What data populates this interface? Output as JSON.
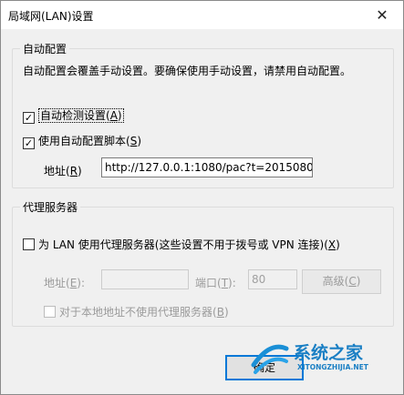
{
  "window": {
    "title": "局域网(LAN)设置",
    "close_glyph": "✕"
  },
  "auto_config": {
    "group_title": "自动配置",
    "description": "自动配置会覆盖手动设置。要确保使用手动设置，请禁用自动配置。",
    "auto_detect": {
      "label": "自动检测设置",
      "accel": "A",
      "checked": true
    },
    "use_script": {
      "label": "使用自动配置脚本",
      "accel": "S",
      "checked": true
    },
    "address_label": "地址",
    "address_accel": "R",
    "address_value": "http://127.0.0.1:1080/pac?t=2015080"
  },
  "proxy": {
    "group_title": "代理服务器",
    "use_proxy": {
      "label": "为 LAN 使用代理服务器(这些设置不用于拨号或 VPN 连接)",
      "accel": "X",
      "checked": false
    },
    "address_label": "地址",
    "address_accel": "E",
    "address_value": "",
    "port_label": "端口",
    "port_accel": "T",
    "port_value": "80",
    "advanced_label": "高级",
    "advanced_accel": "C",
    "bypass": {
      "label": "对于本地地址不使用代理服务器",
      "accel": "B",
      "checked": false
    }
  },
  "footer": {
    "ok_label": "确定"
  },
  "watermark": {
    "brand": "系统之家",
    "url": "XITONGZHIJIA.NET"
  }
}
